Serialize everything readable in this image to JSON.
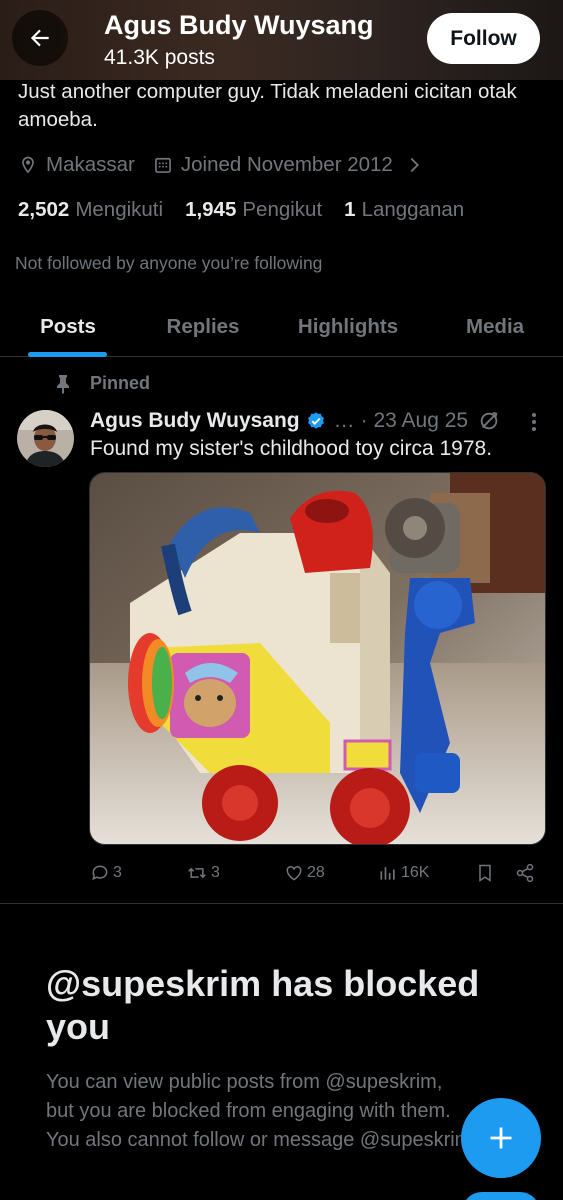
{
  "header": {
    "back_label": "Back",
    "name": "Agus Budy Wuysang",
    "posts_count": "41.3K posts",
    "follow_label": "Follow"
  },
  "profile": {
    "bio": "Just another computer guy. Tidak meladeni cicitan otak amoeba.",
    "location": "Makassar",
    "joined": "Joined November 2012",
    "following_count": "2,502",
    "following_label": "Mengikuti",
    "followers_count": "1,945",
    "followers_label": "Pengikut",
    "subscriptions_count": "1",
    "subscriptions_label": "Langganan",
    "not_followed": "Not followed by anyone you’re following"
  },
  "tabs": [
    {
      "label": "Posts",
      "active": true
    },
    {
      "label": "Replies",
      "active": false
    },
    {
      "label": "Highlights",
      "active": false
    },
    {
      "label": "Media",
      "active": false
    }
  ],
  "post": {
    "pinned_label": "Pinned",
    "author": "Agus Budy Wuysang",
    "handle": "…",
    "date": "· 23 Aug 25",
    "text": "Found my sister's childhood toy circa 1978.",
    "replies": "3",
    "reposts": "3",
    "likes": "28",
    "views": "16K"
  },
  "blocked": {
    "title": "@supeskrim has blocked you",
    "body_line1": "You can view public posts from @supeskrim,",
    "body_line2": "but you are blocked from engaging with them.",
    "body_line3": "You also cannot follow or message @supeskrim."
  },
  "colors": {
    "accent": "#1d9bf0",
    "text_primary": "#e7e9ea",
    "text_secondary": "#71767b",
    "background": "#000000"
  },
  "icons": [
    "back-arrow-icon",
    "location-icon",
    "calendar-icon",
    "chevron-right-icon",
    "pin-icon",
    "verified-badge-icon",
    "edit-history-icon",
    "more-icon",
    "reply-icon",
    "repost-icon",
    "like-icon",
    "views-icon",
    "bookmark-icon",
    "share-icon",
    "plus-icon"
  ]
}
